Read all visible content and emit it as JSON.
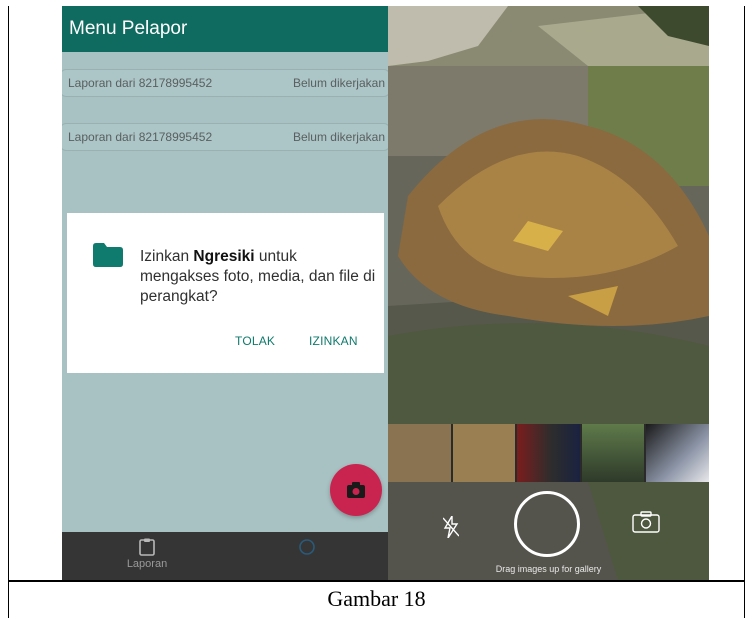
{
  "left_phone": {
    "app_title": "Menu Pelapor",
    "reports": [
      {
        "title": "Laporan dari  82178995452",
        "status": "Belum dikerjakan"
      },
      {
        "title": "Laporan dari  82178995452",
        "status": "Belum dikerjakan"
      }
    ],
    "permission_dialog": {
      "text_before": "Izinkan ",
      "app_name": "Ngresiki",
      "text_after": " untuk mengakses foto, media, dan file di perangkat?",
      "deny_label": "TOLAK",
      "allow_label": "IZINKAN"
    },
    "fab_icon": "camera-icon",
    "bottom_nav": {
      "laporan_label": "Laporan",
      "laporan_icon": "clipboard-icon"
    },
    "colors": {
      "appbar": "#0f6b60",
      "accent_fab": "#c9244f",
      "dialog_button": "#0f7a6c"
    }
  },
  "right_phone": {
    "gallery_hint": "Drag images up for gallery",
    "flash_icon": "flash-off-icon",
    "switch_icon": "switch-camera-icon"
  },
  "caption": "Gambar 18"
}
